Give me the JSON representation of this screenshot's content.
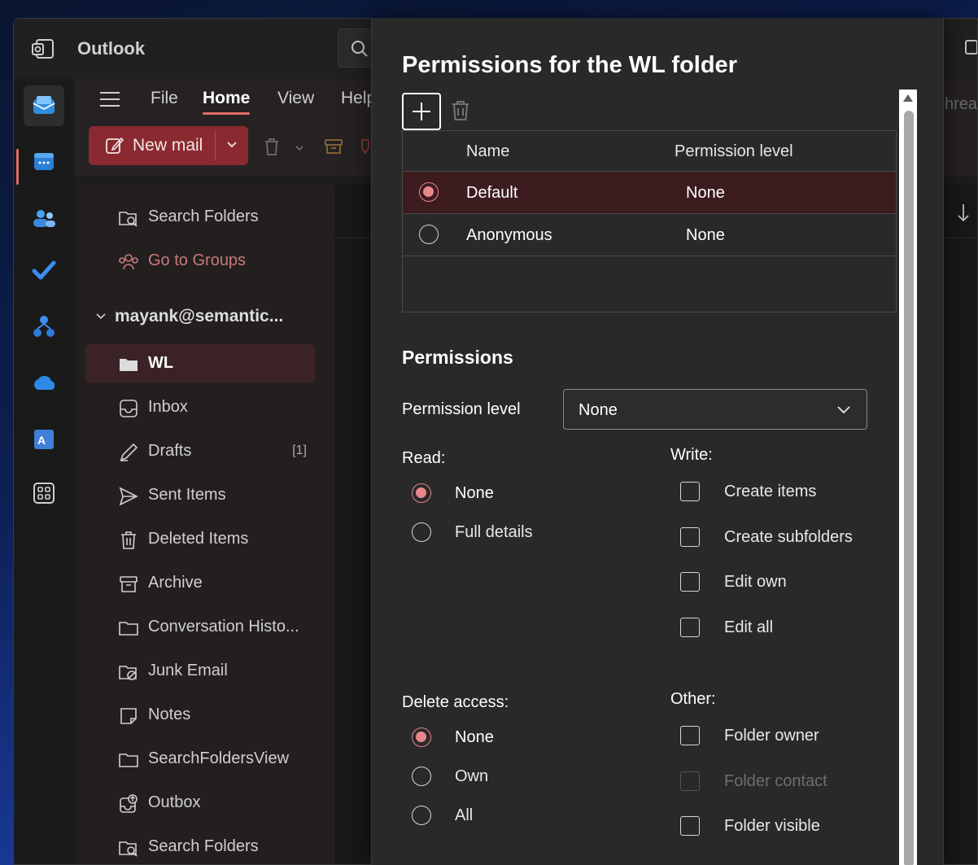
{
  "app": {
    "title": "Outlook"
  },
  "ribbon": {
    "tabs": [
      "File",
      "Home",
      "View",
      "Help"
    ],
    "active_tab": "Home",
    "new_mail_label": "New mail",
    "right_fragment": "hrea"
  },
  "folders": {
    "top_items": [
      {
        "label": "Search Folders",
        "icon": "search-folder-icon"
      },
      {
        "label": "Go to Groups",
        "icon": "groups-icon"
      }
    ],
    "account": "mayank@semantic...",
    "items": [
      {
        "label": "WL",
        "icon": "folder-icon",
        "selected": true
      },
      {
        "label": "Inbox",
        "icon": "inbox-icon"
      },
      {
        "label": "Drafts",
        "icon": "drafts-icon",
        "count": "[1]"
      },
      {
        "label": "Sent Items",
        "icon": "send-icon"
      },
      {
        "label": "Deleted Items",
        "icon": "trash-icon"
      },
      {
        "label": "Archive",
        "icon": "archive-icon"
      },
      {
        "label": "Conversation Histo...",
        "icon": "folder-icon"
      },
      {
        "label": "Junk Email",
        "icon": "junk-icon"
      },
      {
        "label": "Notes",
        "icon": "notes-icon"
      },
      {
        "label": "SearchFoldersView",
        "icon": "folder-icon"
      },
      {
        "label": "Outbox",
        "icon": "outbox-icon"
      },
      {
        "label": "Search Folders",
        "icon": "search-folder-icon"
      }
    ]
  },
  "dialog": {
    "title": "Permissions for the WL folder",
    "table": {
      "headers": [
        "Name",
        "Permission level"
      ],
      "rows": [
        {
          "name": "Default",
          "level": "None",
          "selected": true
        },
        {
          "name": "Anonymous",
          "level": "None",
          "selected": false
        }
      ]
    },
    "permissions_title": "Permissions",
    "permission_level_label": "Permission level",
    "permission_level_value": "None",
    "read": {
      "label": "Read:",
      "options": [
        "None",
        "Full details"
      ],
      "selected": "None"
    },
    "write": {
      "label": "Write:",
      "options": [
        "Create items",
        "Create subfolders",
        "Edit own",
        "Edit all"
      ]
    },
    "delete": {
      "label": "Delete access:",
      "options": [
        "None",
        "Own",
        "All"
      ],
      "selected": "None"
    },
    "other": {
      "label": "Other:",
      "options": [
        "Folder owner",
        "Folder contact",
        "Folder visible"
      ],
      "disabled": [
        "Folder contact"
      ]
    }
  },
  "colors": {
    "accent": "#e9868c",
    "new_mail_bg": "#8a2a30",
    "selected_row": "#3c1c1e"
  }
}
